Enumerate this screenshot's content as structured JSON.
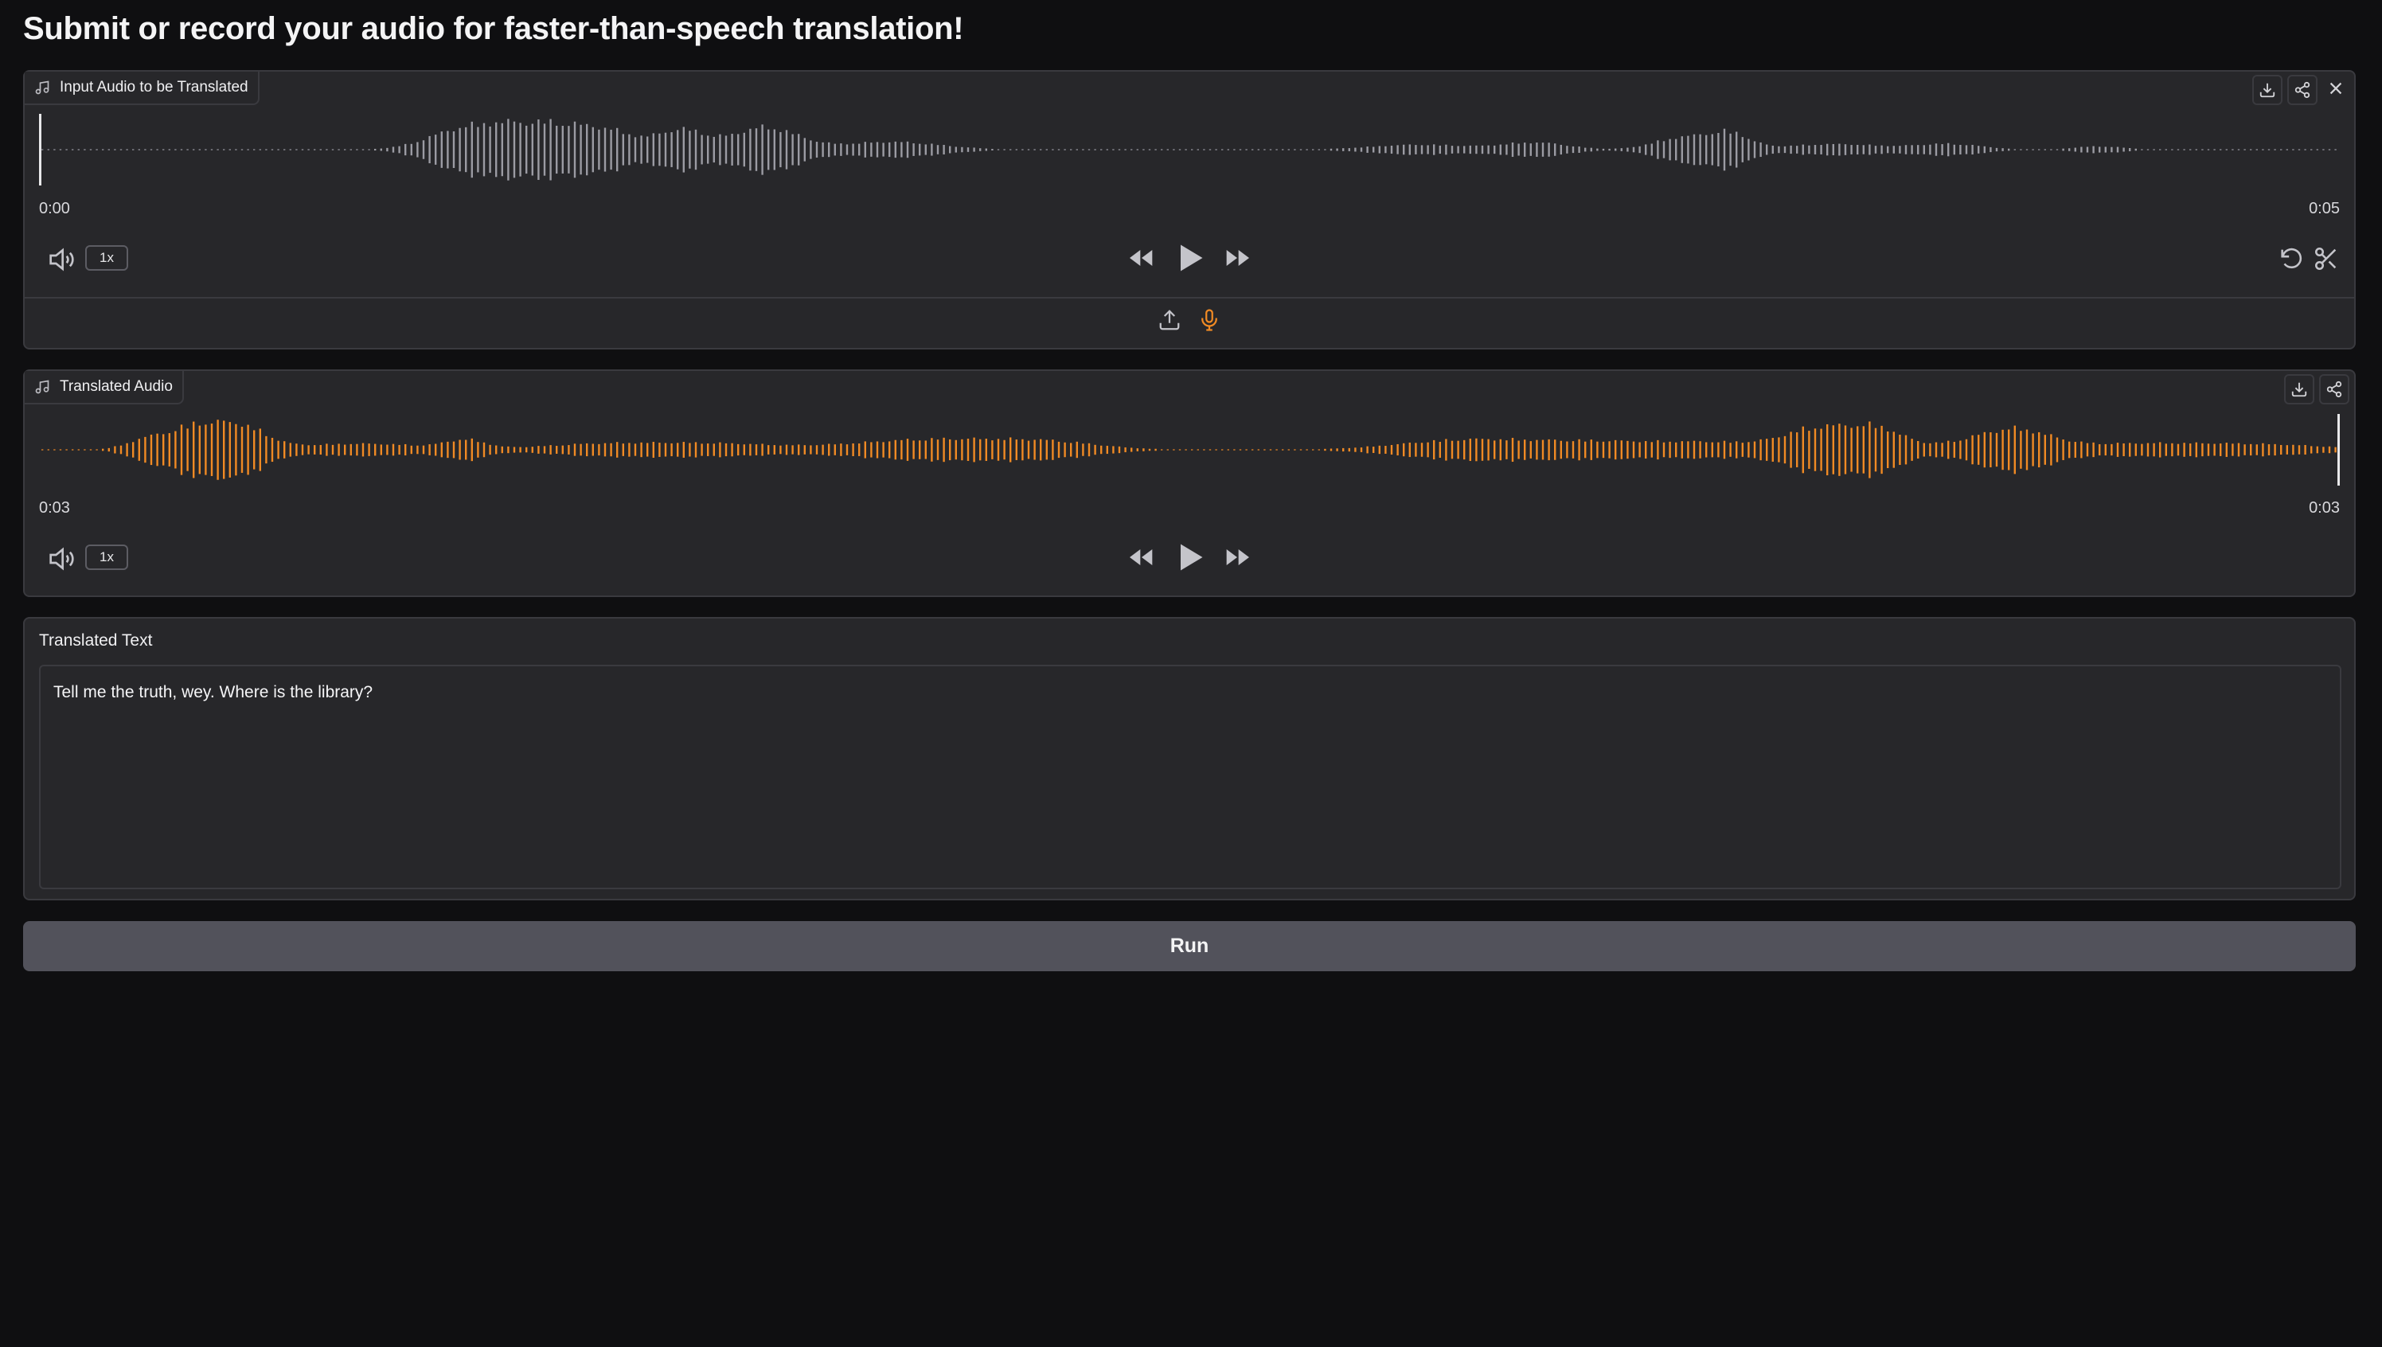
{
  "page": {
    "title": "Submit or record your audio for faster-than-speech translation!"
  },
  "colors": {
    "background": "#0f0f11",
    "panel": "#27272a",
    "border": "#3a3a3f",
    "accent": "#f08a24",
    "waveform_input": "#9b9ba3",
    "run_button": "#52525b"
  },
  "input_audio": {
    "label": "Input Audio to be Translated",
    "label_icon": "music-note-icon",
    "header_icons": [
      "download-icon",
      "share-icon",
      "close-icon"
    ],
    "time_start": "0:00",
    "time_end": "0:05",
    "playhead": 0.0,
    "playback_rate": "1x",
    "controls": [
      "volume-icon",
      "rewind-icon",
      "play-icon",
      "fast-forward-icon",
      "undo-icon",
      "scissors-icon"
    ],
    "source_icons": [
      "upload-icon",
      "microphone-icon"
    ],
    "active_source": "microphone-icon"
  },
  "translated_audio": {
    "label": "Translated Audio",
    "label_icon": "music-note-icon",
    "header_icons": [
      "download-icon",
      "share-icon"
    ],
    "time_start": "0:03",
    "time_end": "0:03",
    "playhead": 1.0,
    "playback_rate": "1x",
    "controls": [
      "volume-icon",
      "rewind-icon",
      "play-icon",
      "fast-forward-icon"
    ]
  },
  "translated_text": {
    "label": "Translated Text",
    "value": "Tell me the truth, wey. Where is the library?"
  },
  "run_button": {
    "label": "Run"
  }
}
